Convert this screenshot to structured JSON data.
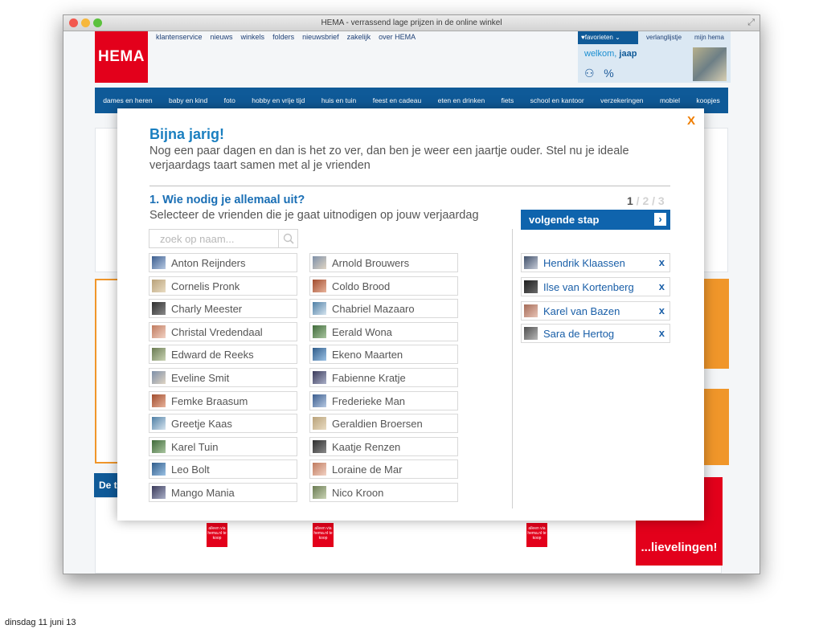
{
  "window": {
    "title": "HEMA - verrassend lage prijzen in de online winkel"
  },
  "site": {
    "logo": "HEMA",
    "topnav": [
      "klantenservice",
      "nieuws",
      "winkels",
      "folders",
      "nieuwsbrief",
      "zakelijk",
      "over HEMA"
    ],
    "favorites": "♥favorieten ⌄",
    "wishlist": "verlanglijstje",
    "my_hema": "mijn hema",
    "welcome_prefix": "welkom,",
    "welcome_user": "jaap",
    "categories": [
      "dames en heren",
      "baby en kind",
      "foto",
      "hobby en vrije tijd",
      "huis en tuin",
      "feest en cadeau",
      "eten en drinken",
      "fiets",
      "school en kantoor",
      "verzekeringen",
      "mobiel",
      "koopjes"
    ],
    "promo_text": "...lievelingen!",
    "promo_tag": "alleen via hema.nl te koop",
    "side_label": "De t"
  },
  "modal": {
    "close_label": "X",
    "title": "Bijna jarig!",
    "intro": "Nog een paar dagen en dan is het zo ver, dan ben je weer een jaartje ouder. Stel nu je ideale verjaardags taart samen met al je vrienden",
    "step_title": "1. Wie nodig je allemaal uit?",
    "step_subtitle": "Selecteer de vrienden die je gaat uitnodigen op jouw verjaardag",
    "step_current": "1",
    "step_rest": " / 2 / 3",
    "next_label": "volgende stap",
    "next_arrow": "›",
    "search_placeholder": "zoek op naam..."
  },
  "friends_col1": [
    "Anton Reijnders",
    "Cornelis Pronk",
    "Charly Meester",
    "Christal Vredendaal",
    "Edward de Reeks",
    "Eveline Smit",
    "Femke Braasum",
    "Greetje Kaas",
    "Karel Tuin",
    "Leo Bolt",
    "Mango Mania"
  ],
  "friends_col2": [
    "Arnold Brouwers",
    "Coldo Brood",
    "Chabriel Mazaaro",
    "Eerald Wona",
    "Ekeno Maarten",
    "Fabienne Kratje",
    "Frederieke Man",
    "Geraldien Broersen",
    "Kaatje Renzen",
    "Loraine de Mar",
    "Nico Kroon"
  ],
  "selected": [
    "Hendrik Klaassen",
    "Ilse van Kortenberg",
    "Karel van Bazen",
    "Sara de Hertog"
  ],
  "remove_label": "x",
  "footer_date": "dinsdag 11 juni 13",
  "colors": {
    "hema_red": "#e3001b",
    "hema_blue": "#0f5a98",
    "link_blue": "#1a7fc0",
    "close_orange": "#ef7d00"
  }
}
